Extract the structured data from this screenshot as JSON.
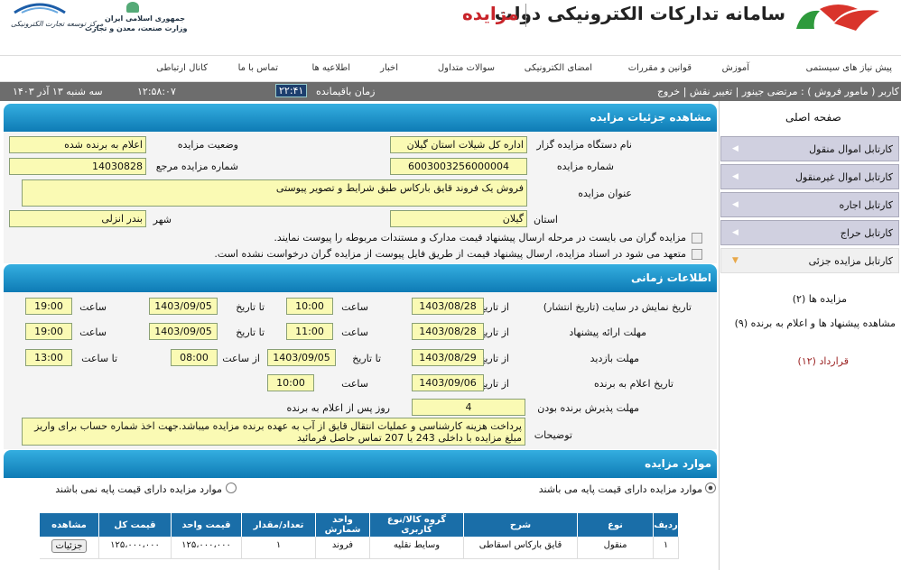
{
  "header": {
    "system_title": "سامانه تدارکات الکترونیکی دولت",
    "module_title": "مزایده",
    "ministry_line1": "جمهوری اسلامی ایران",
    "ministry_line2": "وزارت صنعت، معدن و تجارت",
    "center_name": "مرکز توسعه تجارت الکترونیکی"
  },
  "nav": {
    "items": [
      "پیش نیاز های سیستمی",
      "آموزش",
      "قوانین و مقررات",
      "امضای الکترونیکی",
      "سوالات متداول",
      "اخبار",
      "اطلاعیه ها",
      "تماس با ما",
      "کانال ارتباطی"
    ]
  },
  "status": {
    "user": "کاربر ( مامور فروش ) : مرتضی جینور | تغییر نقش | خروج",
    "remaining_label": "زمان باقیمانده",
    "remaining_value": "۲۲:۴۱",
    "clock": "۱۲:۵۸:۰۷",
    "date": "سه شنبه ۱۳ آذر ۱۴۰۳"
  },
  "sidebar": {
    "home": "صفحه اصلی",
    "items": [
      "کارتابل اموال منقول",
      "کارتابل اموال غیرمنقول",
      "کارتابل اجاره",
      "کارتابل حراج",
      "کارتابل مزایده جزئی"
    ],
    "links": [
      "مزایده ها (۲)",
      "مشاهده پیشنهاد ها و اعلام به برنده (۹)",
      "قرارداد (۱۲)"
    ]
  },
  "details": {
    "section_title": "مشاهده جزئیات مزایده",
    "org_label": "نام دستگاه مزایده گزار",
    "org_value": "اداره کل شیلات استان گیلان",
    "status_label": "وضعیت مزایده",
    "status_value": "اعلام به برنده شده",
    "number_label": "شماره مزایده",
    "number_value": "6003003256000004",
    "ref_label": "شماره مزایده مرجع",
    "ref_value": "14030828",
    "subject_label": "عنوان مزایده",
    "subject_value": "فروش یک فروند قایق بارکاس طبق شرایط و تصویر پیوستی",
    "province_label": "استان",
    "province_value": "گیلان",
    "city_label": "شهر",
    "city_value": "بندر انزلی",
    "check1": "مزایده گران می بایست در مرحله ارسال پیشنهاد قیمت مدارک و مستندات مربوطه را پیوست نمایند.",
    "check2": "متعهد می شود در اسناد مزایده، ارسال پیشنهاد قیمت از طریق فایل پیوست از مزایده گران درخواست نشده است."
  },
  "timing": {
    "section_title": "اطلاعات زمانی",
    "from_label": "از تاریخ",
    "to_label": "تا تاریخ",
    "time_label": "ساعت",
    "from_time_label": "از ساعت",
    "to_time_label": "تا ساعت",
    "row1_label": "تاریخ نمایش در سایت (تاریخ انتشار)",
    "row1_from": "1403/08/28",
    "row1_from_time": "10:00",
    "row1_to": "1403/09/05",
    "row1_to_time": "19:00",
    "row2_label": "مهلت ارائه پیشنهاد",
    "row2_from": "1403/08/28",
    "row2_from_time": "11:00",
    "row2_to": "1403/09/05",
    "row2_to_time": "19:00",
    "row3_label": "مهلت بازدید",
    "row3_from": "1403/08/29",
    "row3_to": "1403/09/05",
    "row3_from_time": "08:00",
    "row3_to_time": "13:00",
    "row4_label": "تاریخ اعلام به برنده",
    "row4_from": "1403/09/06",
    "row4_time": "10:00",
    "accept_label": "مهلت پذیرش برنده بودن",
    "accept_value": "4",
    "accept_suffix": "روز پس از اعلام به برنده",
    "notes_label": "توضیحات",
    "notes_value": "پرداخت هزینه کارشناسی و عملیات انتقال قایق از آب به عهده برنده مزایده میباشد.جهت اخذ شماره حساب برای واریز مبلغ مزایده با داخلی 243 یا 207 تماس حاصل فرمائید"
  },
  "items": {
    "section_title": "موارد مزایده",
    "radio_with": "موارد مزایده دارای قیمت پایه می باشند",
    "radio_without": "موارد مزایده دارای قیمت پایه نمی باشند",
    "columns": [
      "ردیف",
      "نوع",
      "شرح",
      "گروه کالا/نوع کاربری",
      "واحد شمارش",
      "تعداد/مقدار",
      "قیمت واحد",
      "قیمت کل",
      "مشاهده"
    ],
    "rows": [
      [
        "۱",
        "منقول",
        "قایق بارکاس اسقاطی",
        "وسایط نقلیه",
        "فروند",
        "۱",
        "۱۲۵،۰۰۰،۰۰۰",
        "۱۲۵،۰۰۰،۰۰۰",
        "جزئیات"
      ]
    ]
  }
}
